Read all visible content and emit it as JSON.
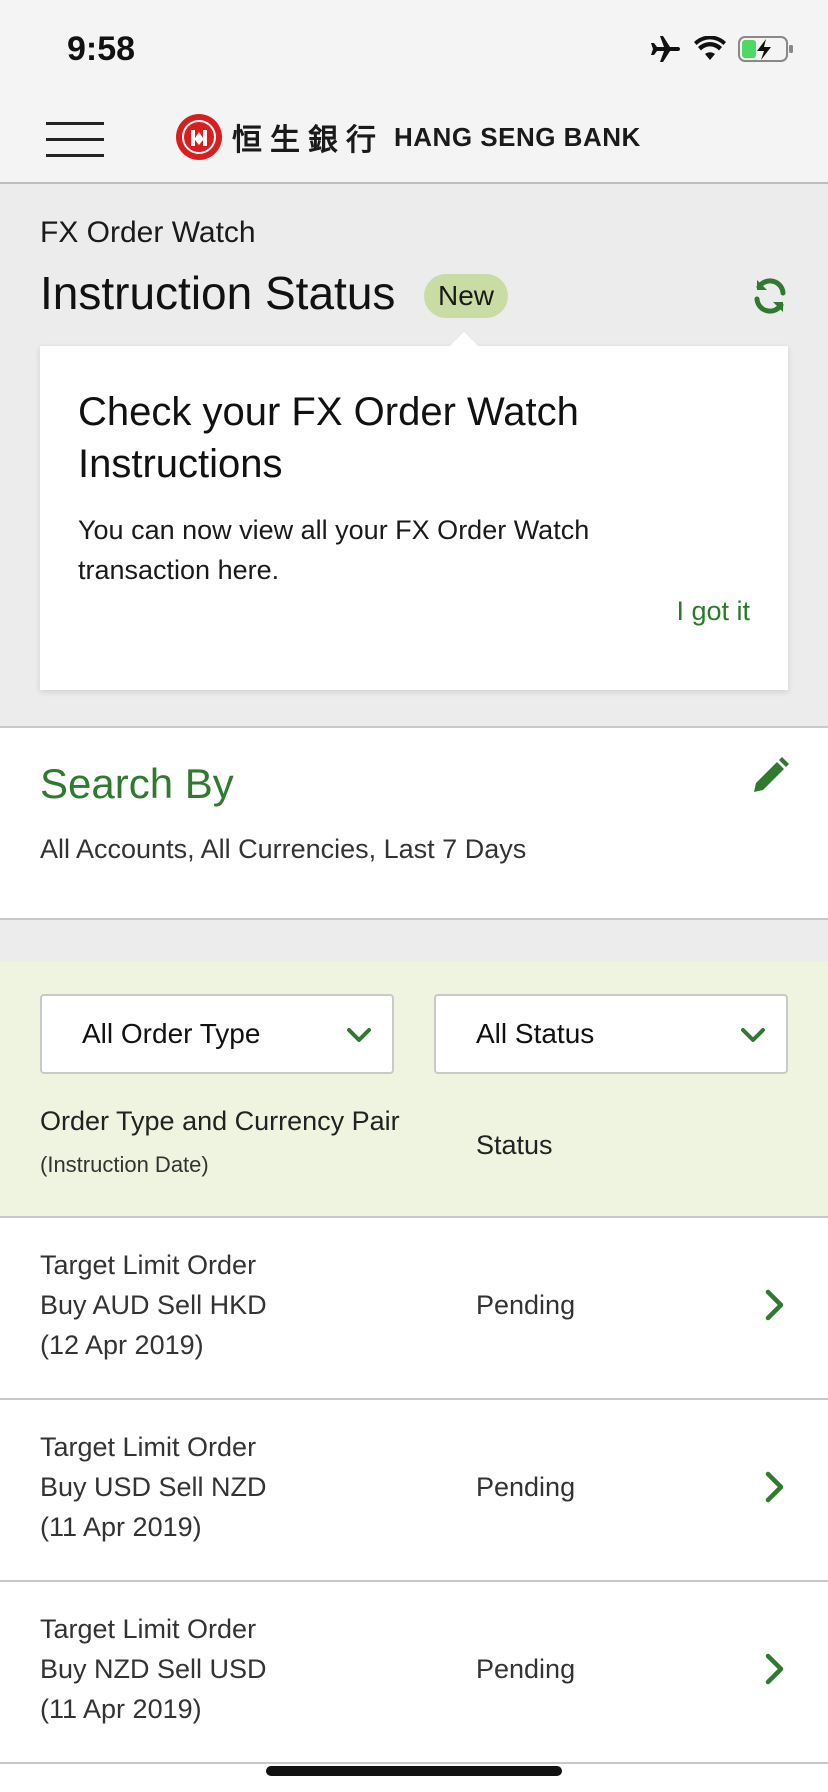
{
  "status_bar": {
    "time": "9:58"
  },
  "header": {
    "brand_cn": "恒生銀行",
    "brand_en": "HANG SENG BANK"
  },
  "page": {
    "kicker": "FX Order Watch",
    "title": "Instruction Status",
    "badge": "New"
  },
  "tooltip": {
    "heading": "Check your FX Order Watch Instructions",
    "body": "You can now view all your FX Order Watch transaction here.",
    "dismiss_label": "I got it"
  },
  "search": {
    "title": "Search By",
    "summary": "All Accounts, All Currencies, Last 7 Days"
  },
  "filters": {
    "order_type_selected": "All Order Type",
    "status_selected": "All Status"
  },
  "table": {
    "col_left": "Order Type and Currency Pair",
    "col_left_sub": "(Instruction Date)",
    "col_right": "Status",
    "rows": [
      {
        "type": "Target Limit Order",
        "pair": "Buy AUD Sell HKD",
        "date": "(12 Apr 2019)",
        "status": "Pending"
      },
      {
        "type": "Target Limit Order",
        "pair": "Buy USD Sell NZD",
        "date": "(11 Apr 2019)",
        "status": "Pending"
      },
      {
        "type": "Target Limit Order",
        "pair": "Buy NZD Sell USD",
        "date": "(11 Apr 2019)",
        "status": "Pending"
      }
    ]
  },
  "colors": {
    "accent_green": "#2f7a2f",
    "brand_red": "#d81e1e",
    "badge_bg": "#c9dca4",
    "filter_bg": "#eef4e0"
  },
  "icons": {
    "menu": "hamburger-menu-icon",
    "refresh": "refresh-icon",
    "edit": "pencil-icon",
    "dropdown": "chevron-down-icon",
    "row": "chevron-right-icon"
  }
}
